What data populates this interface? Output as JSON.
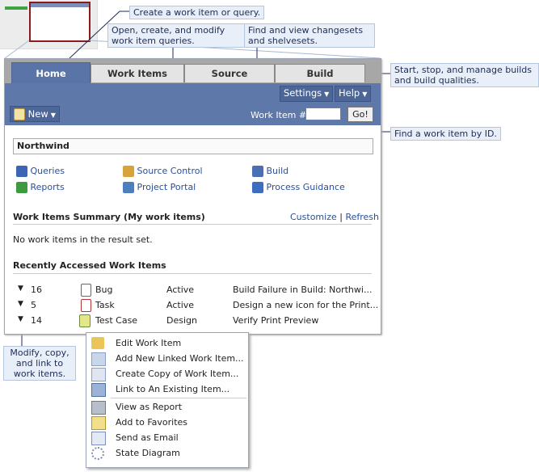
{
  "callouts": {
    "create": "Create a work item or query.",
    "queries": "Open, create, and modify\nwork item queries.",
    "changesets": "Find and view changesets\nand shelvesets.",
    "builds": "Start, stop, and manage builds\nand build qualities.",
    "find": "Find a work item by ID.",
    "modify": "Modify, copy,\nand link to\nwork items."
  },
  "tabs": [
    "Home",
    "Work Items",
    "Source",
    "Build"
  ],
  "toolbar": {
    "settings": "Settings",
    "help": "Help",
    "new": "New",
    "work_item_label": "Work Item #",
    "work_item_value": "",
    "go": "Go!"
  },
  "project": "Northwind",
  "links": [
    {
      "label": "Queries",
      "icon": "queries-icon",
      "color": "#3b66b5"
    },
    {
      "label": "Source Control",
      "icon": "source-control-icon",
      "color": "#d9a33b"
    },
    {
      "label": "Build",
      "icon": "build-icon",
      "color": "#4b6fb3"
    },
    {
      "label": "Reports",
      "icon": "reports-icon",
      "color": "#3f9a3f"
    },
    {
      "label": "Project Portal",
      "icon": "project-portal-icon",
      "color": "#4d7fbf"
    },
    {
      "label": "Process Guidance",
      "icon": "process-guidance-icon",
      "color": "#3e6cc0"
    }
  ],
  "summary": {
    "title": "Work Items Summary (My work items)",
    "customize": "Customize",
    "separator": "|",
    "refresh": "Refresh",
    "empty": "No work items in the result set."
  },
  "recent": {
    "title": "Recently Accessed Work Items",
    "rows": [
      {
        "id": "16",
        "type": "Bug",
        "state": "Active",
        "title": "Build Failure in Build: Northwi..."
      },
      {
        "id": "5",
        "type": "Task",
        "state": "Active",
        "title": "Design a new icon for the Print..."
      },
      {
        "id": "14",
        "type": "Test Case",
        "state": "Design",
        "title": "Verify Print Preview"
      }
    ]
  },
  "menu": {
    "group1": [
      "Edit Work Item",
      "Add New Linked Work Item...",
      "Create Copy of Work Item...",
      "Link to An Existing Item..."
    ],
    "group2": [
      "View as Report",
      "Add to Favorites",
      "Send as Email",
      "State Diagram"
    ]
  }
}
